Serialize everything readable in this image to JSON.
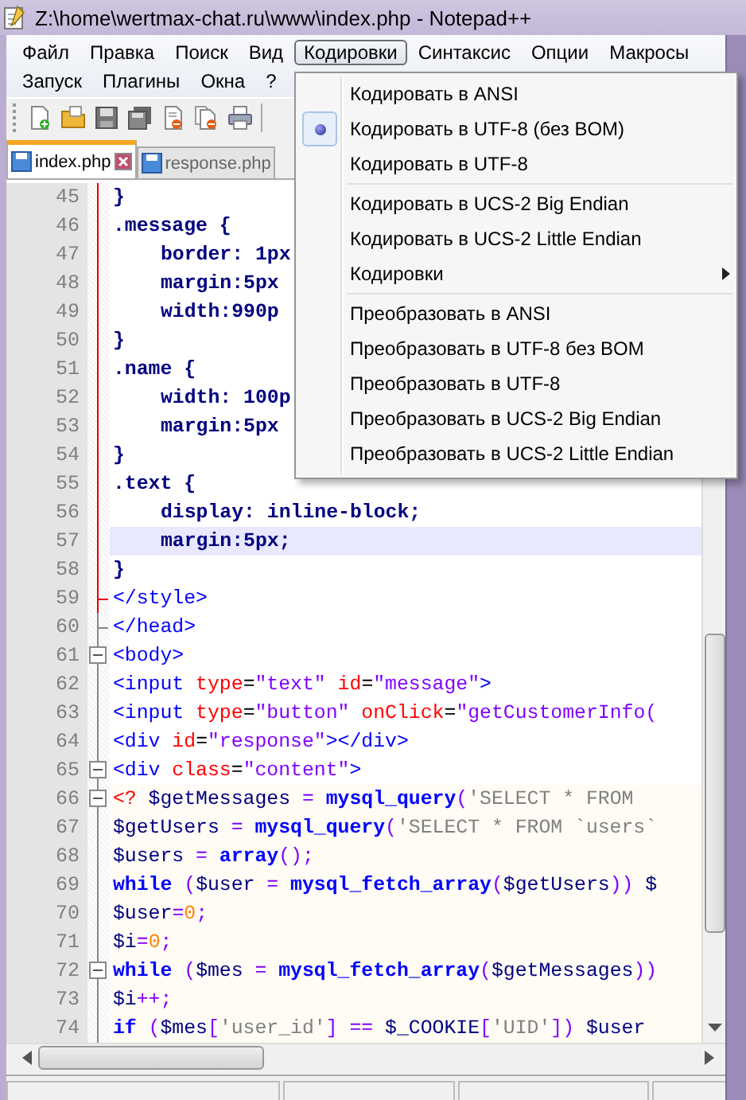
{
  "window": {
    "title": "Z:\\home\\wertmax-chat.ru\\www\\index.php - Notepad++"
  },
  "menu_rows": [
    [
      {
        "label": "Файл",
        "selected": false
      },
      {
        "label": "Правка",
        "selected": false
      },
      {
        "label": "Поиск",
        "selected": false
      },
      {
        "label": "Вид",
        "selected": false
      },
      {
        "label": "Кодировки",
        "selected": true
      },
      {
        "label": "Синтаксис",
        "selected": false
      },
      {
        "label": "Опции",
        "selected": false
      },
      {
        "label": "Макросы",
        "selected": false
      }
    ],
    [
      {
        "label": "Запуск",
        "selected": false
      },
      {
        "label": "Плагины",
        "selected": false
      },
      {
        "label": "Окна",
        "selected": false
      },
      {
        "label": "?",
        "selected": false
      }
    ]
  ],
  "tabs": [
    {
      "label": "index.php",
      "selected": true
    },
    {
      "label": "response.php",
      "selected": false
    }
  ],
  "editor": {
    "lines": [
      {
        "n": "45",
        "indent": false,
        "highlighted": false,
        "fold_box": false,
        "fold_end": false,
        "in_style": true,
        "php": false,
        "tokens": [
          {
            "text": "}",
            "kind": "css"
          }
        ]
      },
      {
        "n": "46",
        "indent": false,
        "highlighted": false,
        "fold_box": false,
        "fold_end": false,
        "in_style": true,
        "php": false,
        "tokens": [
          {
            "text": ".message {",
            "kind": "css"
          }
        ]
      },
      {
        "n": "47",
        "indent": true,
        "highlighted": false,
        "fold_box": false,
        "fold_end": false,
        "in_style": true,
        "php": false,
        "tokens": [
          {
            "text": "border: 1px",
            "kind": "css"
          }
        ]
      },
      {
        "n": "48",
        "indent": true,
        "highlighted": false,
        "fold_box": false,
        "fold_end": false,
        "in_style": true,
        "php": false,
        "tokens": [
          {
            "text": "margin:5px",
            "kind": "css"
          }
        ]
      },
      {
        "n": "49",
        "indent": true,
        "highlighted": false,
        "fold_box": false,
        "fold_end": false,
        "in_style": true,
        "php": false,
        "tokens": [
          {
            "text": "width:990p",
            "kind": "css"
          }
        ]
      },
      {
        "n": "50",
        "indent": false,
        "highlighted": false,
        "fold_box": false,
        "fold_end": false,
        "in_style": true,
        "php": false,
        "tokens": [
          {
            "text": "}",
            "kind": "css"
          }
        ]
      },
      {
        "n": "51",
        "indent": false,
        "highlighted": false,
        "fold_box": false,
        "fold_end": false,
        "in_style": true,
        "php": false,
        "tokens": [
          {
            "text": ".name {",
            "kind": "css"
          }
        ]
      },
      {
        "n": "52",
        "indent": true,
        "highlighted": false,
        "fold_box": false,
        "fold_end": false,
        "in_style": true,
        "php": false,
        "tokens": [
          {
            "text": "width: 100p",
            "kind": "css"
          }
        ]
      },
      {
        "n": "53",
        "indent": true,
        "highlighted": false,
        "fold_box": false,
        "fold_end": false,
        "in_style": true,
        "php": false,
        "tokens": [
          {
            "text": "margin:5px",
            "kind": "css"
          }
        ]
      },
      {
        "n": "54",
        "indent": false,
        "highlighted": false,
        "fold_box": false,
        "fold_end": false,
        "in_style": true,
        "php": false,
        "tokens": [
          {
            "text": "}",
            "kind": "css"
          }
        ]
      },
      {
        "n": "55",
        "indent": false,
        "highlighted": false,
        "fold_box": false,
        "fold_end": false,
        "in_style": true,
        "php": false,
        "tokens": [
          {
            "text": ".text {",
            "kind": "css"
          }
        ]
      },
      {
        "n": "56",
        "indent": true,
        "highlighted": false,
        "fold_box": false,
        "fold_end": false,
        "in_style": true,
        "php": false,
        "tokens": [
          {
            "text": "display: inline-block;",
            "kind": "css"
          }
        ]
      },
      {
        "n": "57",
        "indent": true,
        "highlighted": true,
        "fold_box": false,
        "fold_end": false,
        "in_style": true,
        "php": false,
        "tokens": [
          {
            "text": "margin:5px;",
            "kind": "css"
          }
        ]
      },
      {
        "n": "58",
        "indent": false,
        "highlighted": false,
        "fold_box": false,
        "fold_end": false,
        "in_style": true,
        "php": false,
        "tokens": [
          {
            "text": "}",
            "kind": "css"
          }
        ]
      },
      {
        "n": "59",
        "indent": false,
        "highlighted": false,
        "fold_box": false,
        "fold_end": true,
        "in_style": true,
        "php": false,
        "tokens": [
          {
            "text": "</style>",
            "kind": "tag"
          }
        ]
      },
      {
        "n": "60",
        "indent": false,
        "highlighted": false,
        "fold_box": false,
        "fold_end": true,
        "in_style": false,
        "php": false,
        "tokens": [
          {
            "text": "</head>",
            "kind": "tag"
          }
        ]
      },
      {
        "n": "61",
        "indent": false,
        "highlighted": false,
        "fold_box": true,
        "fold_end": false,
        "in_style": false,
        "php": false,
        "tokens": [
          {
            "text": "<body>",
            "kind": "tag"
          }
        ]
      },
      {
        "n": "62",
        "indent": false,
        "highlighted": false,
        "fold_box": false,
        "fold_end": false,
        "in_style": false,
        "php": false,
        "tokens": [
          {
            "text": "<input",
            "kind": "tag"
          },
          {
            "text": " type",
            "kind": "attr"
          },
          {
            "text": "=",
            "kind": "eq"
          },
          {
            "text": "\"text\"",
            "kind": "str"
          },
          {
            "text": " id",
            "kind": "attr"
          },
          {
            "text": "=",
            "kind": "eq"
          },
          {
            "text": "\"message\"",
            "kind": "str"
          },
          {
            "text": ">",
            "kind": "tag"
          }
        ]
      },
      {
        "n": "63",
        "indent": false,
        "highlighted": false,
        "fold_box": false,
        "fold_end": false,
        "in_style": false,
        "php": false,
        "tokens": [
          {
            "text": "<input",
            "kind": "tag"
          },
          {
            "text": " type",
            "kind": "attr"
          },
          {
            "text": "=",
            "kind": "eq"
          },
          {
            "text": "\"button\"",
            "kind": "str"
          },
          {
            "text": " onClick",
            "kind": "attr"
          },
          {
            "text": "=",
            "kind": "eq"
          },
          {
            "text": "\"getCustomerInfo(",
            "kind": "str"
          }
        ]
      },
      {
        "n": "64",
        "indent": false,
        "highlighted": false,
        "fold_box": false,
        "fold_end": false,
        "in_style": false,
        "php": false,
        "tokens": [
          {
            "text": "<div",
            "kind": "tag"
          },
          {
            "text": " id",
            "kind": "attr"
          },
          {
            "text": "=",
            "kind": "eq"
          },
          {
            "text": "\"response\"",
            "kind": "str"
          },
          {
            "text": "></div>",
            "kind": "tag"
          }
        ]
      },
      {
        "n": "65",
        "indent": false,
        "highlighted": false,
        "fold_box": true,
        "fold_end": false,
        "in_style": false,
        "php": false,
        "tokens": [
          {
            "text": "<div",
            "kind": "tag"
          },
          {
            "text": " class",
            "kind": "attr"
          },
          {
            "text": "=",
            "kind": "eq"
          },
          {
            "text": "\"content\"",
            "kind": "str"
          },
          {
            "text": ">",
            "kind": "tag"
          }
        ]
      },
      {
        "n": "66",
        "indent": false,
        "highlighted": false,
        "fold_box": true,
        "fold_end": false,
        "in_style": false,
        "php": true,
        "tokens": [
          {
            "text": "<?",
            "kind": "phptag"
          },
          {
            "text": " $getMessages",
            "kind": "var"
          },
          {
            "text": " =",
            "kind": "op"
          },
          {
            "text": " mysql_query",
            "kind": "func"
          },
          {
            "text": "(",
            "kind": "op"
          },
          {
            "text": "'SELECT * FROM",
            "kind": "sql"
          }
        ]
      },
      {
        "n": "67",
        "indent": false,
        "highlighted": false,
        "fold_box": false,
        "fold_end": false,
        "in_style": false,
        "php": true,
        "tokens": [
          {
            "text": "$getUsers",
            "kind": "var"
          },
          {
            "text": " =",
            "kind": "op"
          },
          {
            "text": " mysql_query",
            "kind": "func"
          },
          {
            "text": "(",
            "kind": "op"
          },
          {
            "text": "'SELECT * FROM `users`",
            "kind": "sql"
          }
        ]
      },
      {
        "n": "68",
        "indent": false,
        "highlighted": false,
        "fold_box": false,
        "fold_end": false,
        "in_style": false,
        "php": true,
        "tokens": [
          {
            "text": "$users",
            "kind": "var"
          },
          {
            "text": " =",
            "kind": "op"
          },
          {
            "text": " array",
            "kind": "func"
          },
          {
            "text": "();",
            "kind": "op"
          }
        ]
      },
      {
        "n": "69",
        "indent": false,
        "highlighted": false,
        "fold_box": false,
        "fold_end": false,
        "in_style": false,
        "php": true,
        "tokens": [
          {
            "text": "while",
            "kind": "kw"
          },
          {
            "text": " (",
            "kind": "op"
          },
          {
            "text": "$user",
            "kind": "var"
          },
          {
            "text": " =",
            "kind": "op"
          },
          {
            "text": " mysql_fetch_array",
            "kind": "func"
          },
          {
            "text": "(",
            "kind": "op"
          },
          {
            "text": "$getUsers",
            "kind": "var"
          },
          {
            "text": "))",
            "kind": "op"
          },
          {
            "text": " $",
            "kind": "var"
          }
        ]
      },
      {
        "n": "70",
        "indent": false,
        "highlighted": false,
        "fold_box": false,
        "fold_end": false,
        "in_style": false,
        "php": true,
        "tokens": [
          {
            "text": "$user",
            "kind": "var"
          },
          {
            "text": "=",
            "kind": "op"
          },
          {
            "text": "0",
            "kind": "num"
          },
          {
            "text": ";",
            "kind": "op"
          }
        ]
      },
      {
        "n": "71",
        "indent": false,
        "highlighted": false,
        "fold_box": false,
        "fold_end": false,
        "in_style": false,
        "php": true,
        "tokens": [
          {
            "text": "$i",
            "kind": "var"
          },
          {
            "text": "=",
            "kind": "op"
          },
          {
            "text": "0",
            "kind": "num"
          },
          {
            "text": ";",
            "kind": "op"
          }
        ]
      },
      {
        "n": "72",
        "indent": false,
        "highlighted": false,
        "fold_box": true,
        "fold_end": false,
        "in_style": false,
        "php": true,
        "tokens": [
          {
            "text": "while",
            "kind": "kw"
          },
          {
            "text": " (",
            "kind": "op"
          },
          {
            "text": "$mes",
            "kind": "var"
          },
          {
            "text": " =",
            "kind": "op"
          },
          {
            "text": " mysql_fetch_array",
            "kind": "func"
          },
          {
            "text": "(",
            "kind": "op"
          },
          {
            "text": "$getMessages",
            "kind": "var"
          },
          {
            "text": "))",
            "kind": "op"
          }
        ]
      },
      {
        "n": "73",
        "indent": false,
        "highlighted": false,
        "fold_box": false,
        "fold_end": false,
        "in_style": false,
        "php": true,
        "tokens": [
          {
            "text": "$i",
            "kind": "var"
          },
          {
            "text": "++;",
            "kind": "op"
          }
        ]
      },
      {
        "n": "74",
        "indent": false,
        "highlighted": false,
        "fold_box": false,
        "fold_end": false,
        "in_style": false,
        "php": true,
        "tokens": [
          {
            "text": "if",
            "kind": "kw"
          },
          {
            "text": " (",
            "kind": "op"
          },
          {
            "text": "$mes",
            "kind": "var"
          },
          {
            "text": "[",
            "kind": "op"
          },
          {
            "text": "'user_id'",
            "kind": "sql"
          },
          {
            "text": "]",
            "kind": "op"
          },
          {
            "text": " ==",
            "kind": "op"
          },
          {
            "text": " $_COOKIE",
            "kind": "var"
          },
          {
            "text": "[",
            "kind": "op"
          },
          {
            "text": "'UID'",
            "kind": "sql"
          },
          {
            "text": "])",
            "kind": "op"
          },
          {
            "text": " $user",
            "kind": "var"
          }
        ]
      }
    ]
  },
  "encoding_menu": {
    "items": [
      {
        "kind": "item",
        "label": "Кодировать в ANSI",
        "checked": false
      },
      {
        "kind": "item",
        "label": "Кодировать в UTF-8 (без BOM)",
        "checked": true
      },
      {
        "kind": "item",
        "label": "Кодировать в UTF-8",
        "checked": false
      },
      {
        "kind": "separator"
      },
      {
        "kind": "item",
        "label": "Кодировать в UCS-2 Big Endian",
        "checked": false
      },
      {
        "kind": "item",
        "label": "Кодировать в UCS-2 Little Endian",
        "checked": false
      },
      {
        "kind": "submenu",
        "label": "Кодировки"
      },
      {
        "kind": "separator"
      },
      {
        "kind": "item",
        "label": "Преобразовать в ANSI",
        "checked": false
      },
      {
        "kind": "item",
        "label": "Преобразовать в UTF-8 без BOM",
        "checked": false
      },
      {
        "kind": "item",
        "label": "Преобразовать в UTF-8",
        "checked": false
      },
      {
        "kind": "item",
        "label": "Преобразовать в UCS-2 Big Endian",
        "checked": false
      },
      {
        "kind": "item",
        "label": "Преобразовать в UCS-2 Little Endian",
        "checked": false
      }
    ]
  }
}
